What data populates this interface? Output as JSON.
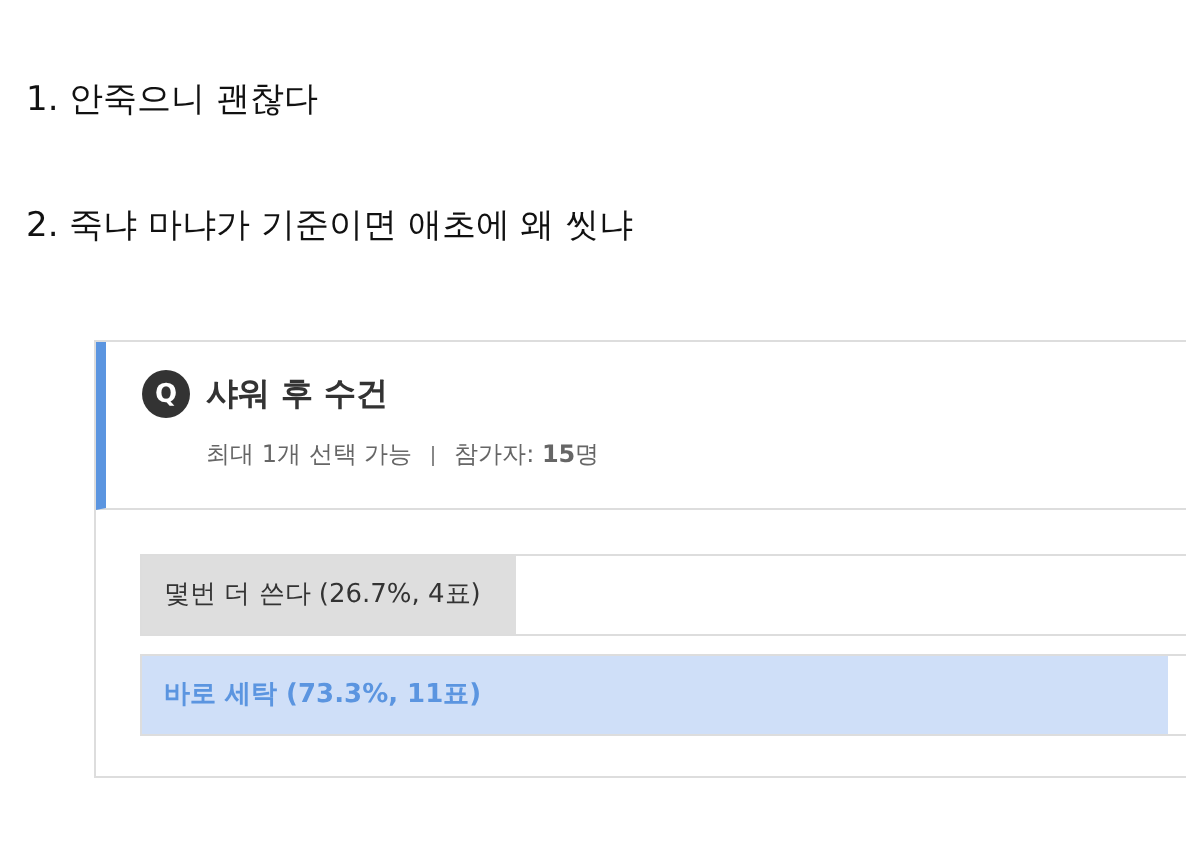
{
  "lines": [
    "1. 안죽으니 괜찮다",
    "2. 죽냐 마냐가 기준이면 애초에 왜 씻냐"
  ],
  "poll": {
    "badge": "Q",
    "title": "샤워 후 수건",
    "limit": "최대 1개 선택 가능",
    "participants": "참가자: **15**명",
    "options": [
      {
        "label": "몇번 더 쓴다 (26.7%, 4표)",
        "level": 0.267,
        "leading": false
      },
      {
        "label": "바로 세탁 (73.3%, 11표)",
        "level": 0.733,
        "leading": true
      }
    ]
  }
}
